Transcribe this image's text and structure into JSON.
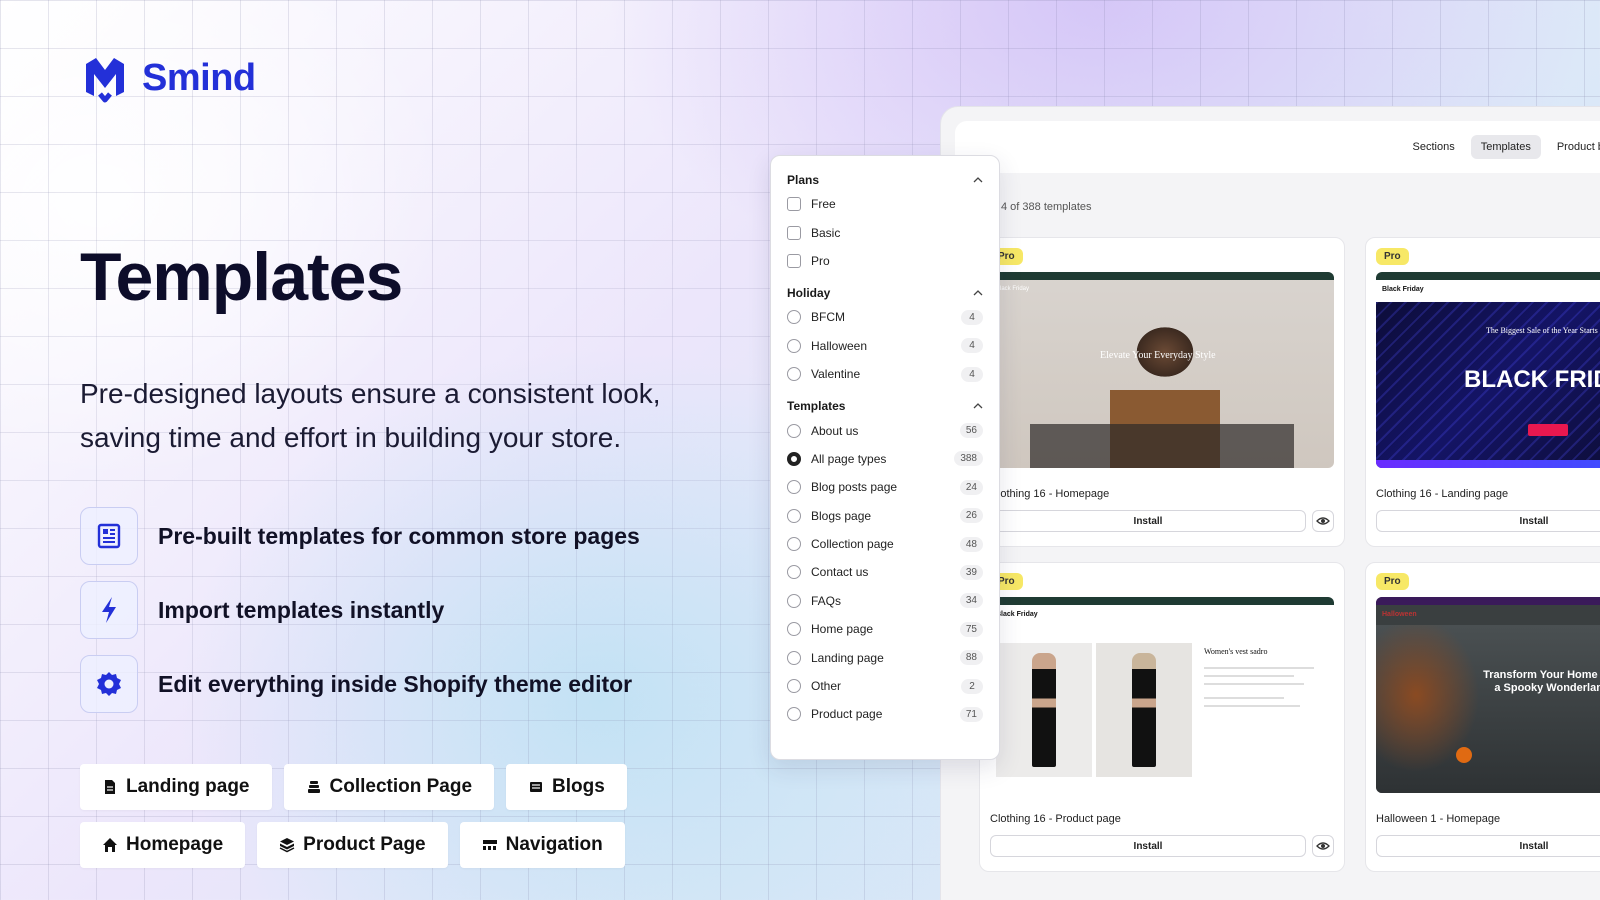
{
  "brand": {
    "name": "Smind",
    "color": "#2330d8"
  },
  "hero": {
    "title": "Templates",
    "description": "Pre-designed layouts ensure a consistent look, saving time and effort in building your store."
  },
  "features": [
    {
      "icon": "document-icon",
      "label": "Pre-built templates for common store pages"
    },
    {
      "icon": "lightning-icon",
      "label": "Import templates instantly"
    },
    {
      "icon": "gear-icon",
      "label": "Edit everything inside Shopify theme editor"
    }
  ],
  "chips": [
    {
      "icon": "file-icon",
      "label": "Landing page"
    },
    {
      "icon": "layers-icon",
      "label": "Collection Page"
    },
    {
      "icon": "newspaper-icon",
      "label": "Blogs"
    },
    {
      "icon": "home-icon",
      "label": "Homepage"
    },
    {
      "icon": "cube-icon",
      "label": "Product Page"
    },
    {
      "icon": "navigation-icon",
      "label": "Navigation"
    }
  ],
  "app": {
    "tabs": [
      {
        "label": "Sections",
        "active": false
      },
      {
        "label": "Templates",
        "active": true
      },
      {
        "label": "Product blocks",
        "active": false
      }
    ],
    "count_text": "4 of 388 templates",
    "install_label": "Install",
    "cards": [
      {
        "badge": "Pro",
        "name": "Clothing 16 - Homepage",
        "thumb_text": "Elevate Your Everyday Style",
        "thumb_brand": "Black Friday"
      },
      {
        "badge": "Pro",
        "name": "Clothing 16 - Landing page",
        "thumb_text": "BLACK FRID",
        "thumb_sub": "The Biggest Sale of the Year Starts",
        "thumb_brand": "Black Friday"
      },
      {
        "badge": "Pro",
        "name": "Clothing 16 - Product page",
        "thumb_text": "Women's vest sadro",
        "thumb_brand": "Black Friday"
      },
      {
        "badge": "Pro",
        "name": "Halloween 1 - Homepage",
        "thumb_text": "Transform Your Home into a Spooky Wonderland",
        "thumb_brand": "Halloween"
      }
    ]
  },
  "filters": {
    "plans": {
      "title": "Plans",
      "items": [
        {
          "label": "Free"
        },
        {
          "label": "Basic"
        },
        {
          "label": "Pro"
        }
      ]
    },
    "holiday": {
      "title": "Holiday",
      "items": [
        {
          "label": "BFCM",
          "count": "4"
        },
        {
          "label": "Halloween",
          "count": "4"
        },
        {
          "label": "Valentine",
          "count": "4"
        }
      ]
    },
    "templates": {
      "title": "Templates",
      "items": [
        {
          "label": "About us",
          "count": "56"
        },
        {
          "label": "All page types",
          "count": "388",
          "checked": true
        },
        {
          "label": "Blog posts page",
          "count": "24"
        },
        {
          "label": "Blogs page",
          "count": "26"
        },
        {
          "label": "Collection page",
          "count": "48"
        },
        {
          "label": "Contact us",
          "count": "39"
        },
        {
          "label": "FAQs",
          "count": "34"
        },
        {
          "label": "Home page",
          "count": "75"
        },
        {
          "label": "Landing page",
          "count": "88"
        },
        {
          "label": "Other",
          "count": "2"
        },
        {
          "label": "Product page",
          "count": "71"
        }
      ]
    }
  }
}
